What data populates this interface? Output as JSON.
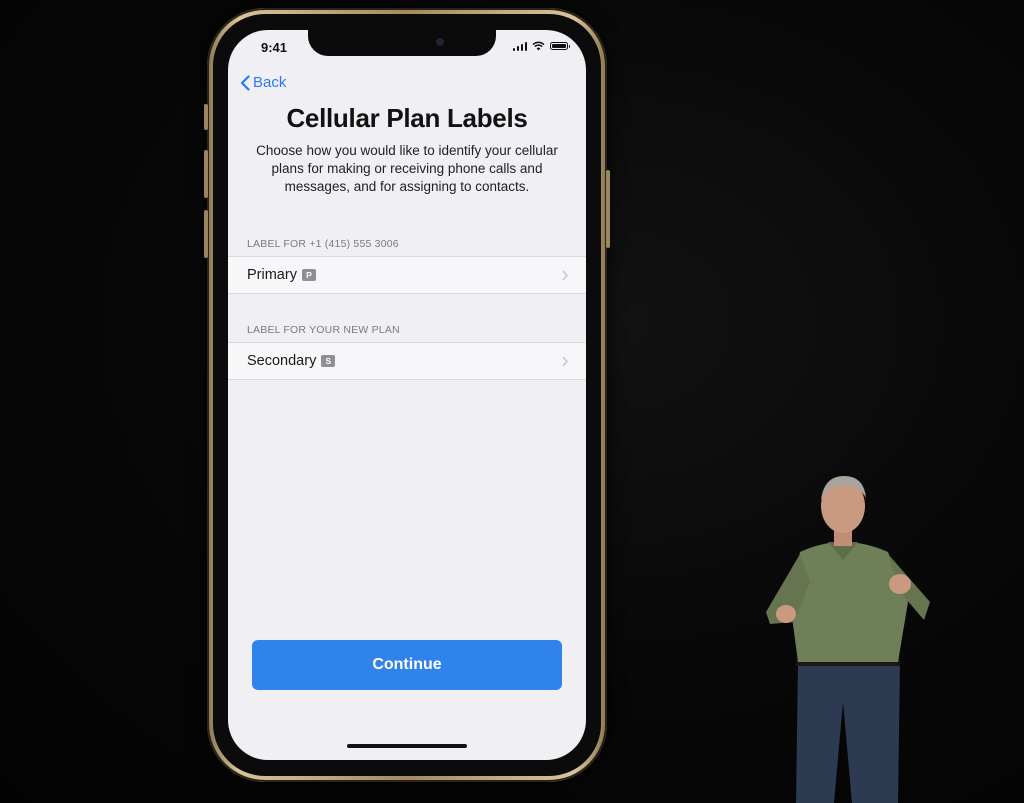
{
  "status_bar": {
    "time": "9:41",
    "signal_icon": "cellular-signal-icon",
    "wifi_icon": "wifi-icon",
    "battery_icon": "battery-icon"
  },
  "nav": {
    "back_label": "Back",
    "back_icon": "chevron-left-icon"
  },
  "page": {
    "title": "Cellular Plan Labels",
    "description": "Choose how you would like to identify your cellular plans for making or receiving phone calls and messages, and for assigning to contacts."
  },
  "sections": [
    {
      "header": "LABEL FOR +1 (415) 555 3006",
      "cell_label": "Primary",
      "badge": "P"
    },
    {
      "header": "LABEL FOR YOUR NEW PLAN",
      "cell_label": "Secondary",
      "badge": "S"
    }
  ],
  "actions": {
    "continue_label": "Continue"
  },
  "colors": {
    "accent": "#2f83ea",
    "link": "#2a7bf0",
    "screen_background": "#efeff4",
    "phone_frame": "#c9b287"
  }
}
